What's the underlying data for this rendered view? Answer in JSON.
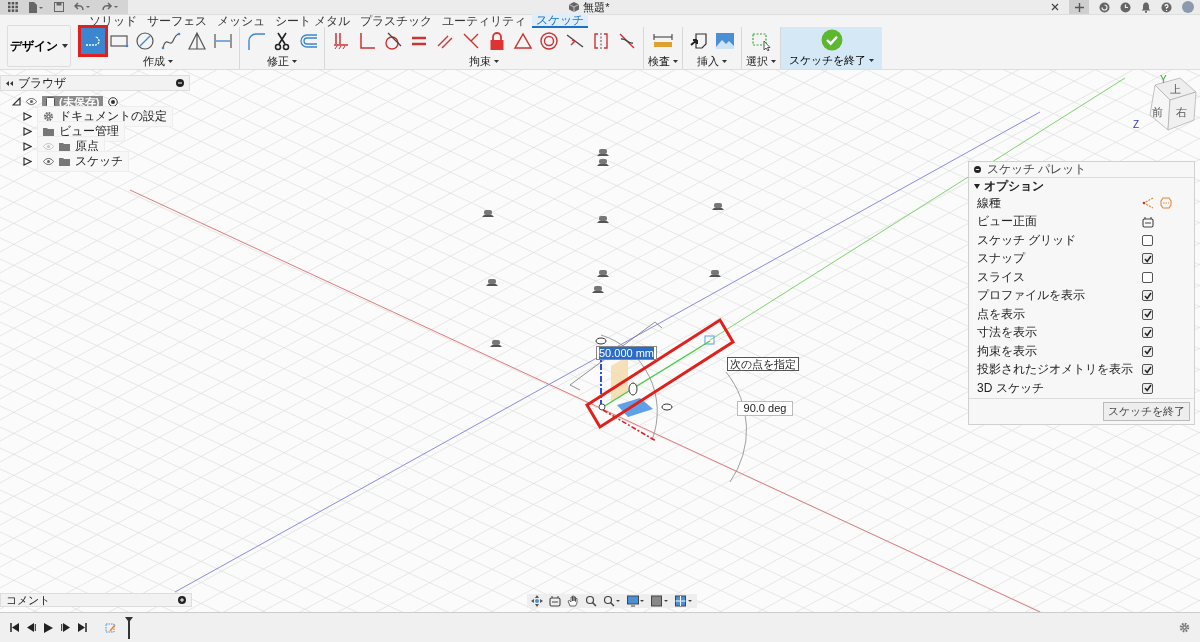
{
  "title_bar": {
    "document_title": "無題*"
  },
  "ribbon": {
    "workspace": "デザイン",
    "tabs": [
      {
        "label": "ソリッド",
        "selected": false
      },
      {
        "label": "サーフェス",
        "selected": false
      },
      {
        "label": "メッシュ",
        "selected": false
      },
      {
        "label": "シート メタル",
        "selected": false
      },
      {
        "label": "プラスチック",
        "selected": false
      },
      {
        "label": "ユーティリティ",
        "selected": false
      },
      {
        "label": "スケッチ",
        "selected": true
      }
    ],
    "groups": [
      {
        "label": "作成",
        "kind": "tools",
        "tools": [
          {
            "kind": "line",
            "selected": true
          },
          {
            "kind": "rectangle",
            "selected": false
          },
          {
            "kind": "circle",
            "selected": false
          },
          {
            "kind": "spline",
            "selected": false
          },
          {
            "kind": "triangle",
            "selected": false
          },
          {
            "kind": "bracket",
            "selected": false
          }
        ]
      },
      {
        "label": "修正",
        "kind": "tools",
        "tools": [
          {
            "kind": "fillet",
            "selected": false
          },
          {
            "kind": "scissors",
            "selected": false
          },
          {
            "kind": "offset",
            "selected": false
          }
        ]
      },
      {
        "label": "拘束",
        "kind": "tools",
        "tools": [
          {
            "kind": "fix",
            "selected": false
          },
          {
            "kind": "perpendicular",
            "selected": false
          },
          {
            "kind": "tangent",
            "selected": false
          },
          {
            "kind": "equal",
            "selected": false
          },
          {
            "kind": "parallel",
            "selected": false
          },
          {
            "kind": "angle",
            "selected": false
          },
          {
            "kind": "lock",
            "selected": false
          },
          {
            "kind": "warning",
            "selected": false
          },
          {
            "kind": "concentric",
            "selected": false
          },
          {
            "kind": "midpoint",
            "selected": false
          },
          {
            "kind": "symmetry",
            "selected": false
          },
          {
            "kind": "curvature",
            "selected": false
          }
        ]
      },
      {
        "label": "検査",
        "kind": "tools",
        "tools": [
          {
            "kind": "ruler",
            "selected": false
          }
        ]
      },
      {
        "label": "挿入",
        "kind": "tools",
        "tools": [
          {
            "kind": "insert",
            "selected": false
          },
          {
            "kind": "image",
            "selected": false
          }
        ]
      },
      {
        "label": "選択",
        "kind": "tools",
        "tools": [
          {
            "kind": "select",
            "selected": false
          }
        ]
      },
      {
        "label": "スケッチを終了",
        "kind": "finish"
      }
    ]
  },
  "browser": {
    "title": "ブラウザ",
    "root": {
      "label": "(未保存)",
      "expanded": true,
      "visible": true,
      "active": true,
      "children": [
        {
          "label": "ドキュメントの設定",
          "kind": "settings",
          "expanded": false
        },
        {
          "label": "ビュー管理",
          "kind": "folder",
          "expanded": false
        },
        {
          "label": "原点",
          "kind": "toggle-folder",
          "visible": false,
          "expanded": false
        },
        {
          "label": "スケッチ",
          "kind": "toggle-folder",
          "visible": true,
          "expanded": false
        }
      ]
    }
  },
  "viewport": {
    "dimension_input": {
      "value": "50.000 mm"
    },
    "tooltip": "次の点を指定",
    "angle_input": {
      "value": "90.0 deg"
    },
    "viewcube": {
      "top": "上",
      "front": "前",
      "right": "右"
    },
    "axis_labels": {
      "y": "Y",
      "z": "Z"
    }
  },
  "sketch_palette": {
    "title": "スケッチ パレット",
    "section": {
      "label": "オプション",
      "expanded": true
    },
    "rows": [
      {
        "label": "線種",
        "kind": "linetype"
      },
      {
        "label": "ビュー正面",
        "kind": "look-at"
      },
      {
        "label": "スケッチ グリッド",
        "kind": "checkbox",
        "checked": false
      },
      {
        "label": "スナップ",
        "kind": "checkbox",
        "checked": true
      },
      {
        "label": "スライス",
        "kind": "checkbox",
        "checked": false
      },
      {
        "label": "プロファイルを表示",
        "kind": "checkbox",
        "checked": true
      },
      {
        "label": "点を表示",
        "kind": "checkbox",
        "checked": true
      },
      {
        "label": "寸法を表示",
        "kind": "checkbox",
        "checked": true
      },
      {
        "label": "拘束を表示",
        "kind": "checkbox",
        "checked": true
      },
      {
        "label": "投影されたジオメトリを表示",
        "kind": "checkbox",
        "checked": true
      },
      {
        "label": "3D スケッチ",
        "kind": "checkbox",
        "checked": true
      }
    ],
    "button": "スケッチを終了"
  },
  "comments": {
    "title": "コメント"
  }
}
